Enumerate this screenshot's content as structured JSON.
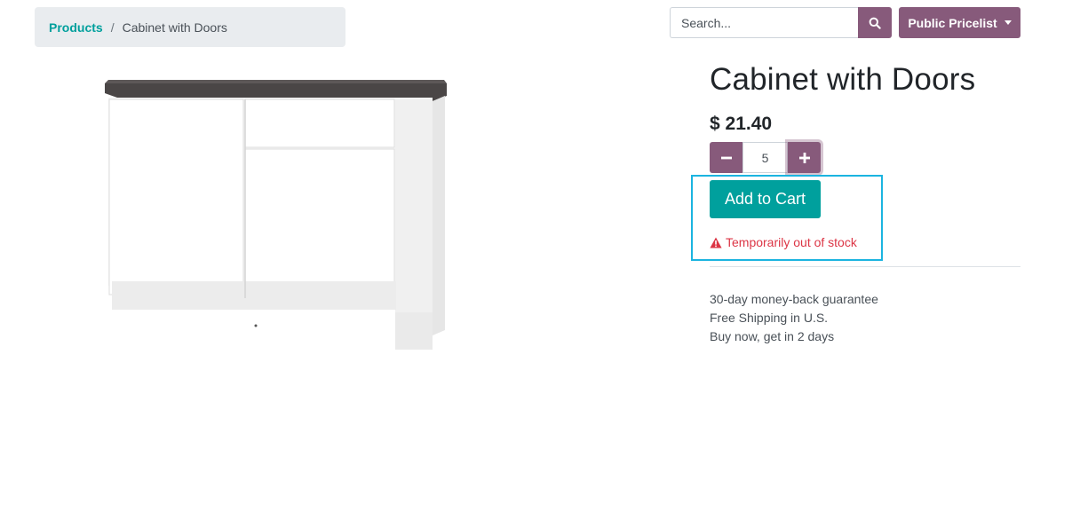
{
  "breadcrumb": {
    "parent": "Products",
    "separator": "/",
    "current": "Cabinet with Doors"
  },
  "search": {
    "placeholder": "Search...",
    "icon": "search-icon"
  },
  "pricelist": {
    "label": "Public Pricelist"
  },
  "product": {
    "title": "Cabinet with Doors",
    "price": "$ 21.40",
    "quantity": "5",
    "add_to_cart_label": "Add to Cart",
    "stock_warning": "Temporarily out of stock",
    "image": "cabinet-with-doors-image"
  },
  "guarantees": [
    "30-day money-back guarantee",
    "Free Shipping in U.S.",
    "Buy now, get in 2 days"
  ],
  "colors": {
    "primary": "#875a7b",
    "accent": "#00a09d",
    "danger": "#dc3545",
    "highlight": "#1bb4e0"
  }
}
